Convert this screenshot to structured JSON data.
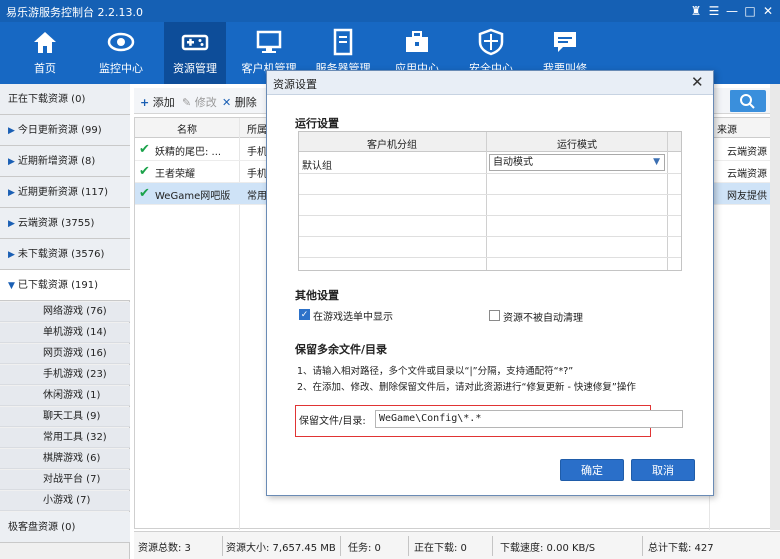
{
  "window": {
    "title": "易乐游服务控制台 2.2.13.0"
  },
  "nav": [
    {
      "label": "首页",
      "icon": "home-icon"
    },
    {
      "label": "监控中心",
      "icon": "eye-icon"
    },
    {
      "label": "资源管理",
      "icon": "gamepad-icon",
      "active": true
    },
    {
      "label": "客户机管理",
      "icon": "monitor-icon"
    },
    {
      "label": "服务器管理",
      "icon": "server-icon"
    },
    {
      "label": "应用中心",
      "icon": "toolbox-icon"
    },
    {
      "label": "安全中心",
      "icon": "shield-icon"
    },
    {
      "label": "我要叫修",
      "icon": "chat-icon"
    }
  ],
  "sidebar": {
    "items": [
      "正在下载资源 (0)",
      "今日更新资源 (99)",
      "近期新增资源 (8)",
      "近期更新资源 (117)",
      "云端资源 (3755)",
      "未下载资源 (3576)",
      "已下载资源 (191)"
    ],
    "subitems": [
      "网络游戏 (76)",
      "单机游戏 (14)",
      "网页游戏 (16)",
      "手机游戏 (23)",
      "休闲游戏 (1)",
      "聊天工具 (9)",
      "常用工具 (32)",
      "棋牌游戏 (6)",
      "对战平台 (7)",
      "小游戏 (7)"
    ],
    "bottom": "极客盘资源 (0)"
  },
  "toolbar": {
    "add": "添加",
    "edit": "修改",
    "delete": "删除"
  },
  "grid": {
    "headers": {
      "name": "名称",
      "group": "所属",
      "source": "来源"
    },
    "rows": [
      {
        "name": "妖精的尾巴: ...",
        "group": "手机",
        "source": "云端资源"
      },
      {
        "name": "王者荣耀",
        "group": "手机",
        "source": "云端资源"
      },
      {
        "name": "WeGame网吧版",
        "group": "常用",
        "source": "网友提供"
      }
    ]
  },
  "status": {
    "total": "资源总数: 3",
    "size": "资源大小: 7,657.45 MB",
    "tasks": "任务: 0",
    "downloading": "正在下载: 0",
    "speed": "下载速度: 0.00 KB/S",
    "sum": "总计下载: 427"
  },
  "dialog": {
    "title": "资源设置",
    "run_section": "运行设置",
    "col_group": "客户机分组",
    "col_mode": "运行模式",
    "row_group": "默认组",
    "row_mode": "自动模式",
    "other_section": "其他设置",
    "opt1": "在游戏选单中显示",
    "opt2": "资源不被自动清理",
    "keep_section": "保留多余文件/目录",
    "note1": "1、请输入相对路径，多个文件或目录以“|”分隔，支持通配符“*?”",
    "note2": "2、在添加、修改、删除保留文件后，请对此资源进行“修复更新 - 快速修复”操作",
    "keep_label": "保留文件/目录:",
    "keep_value": "WeGame\\Config\\*.*",
    "ok": "确定",
    "cancel": "取消"
  }
}
